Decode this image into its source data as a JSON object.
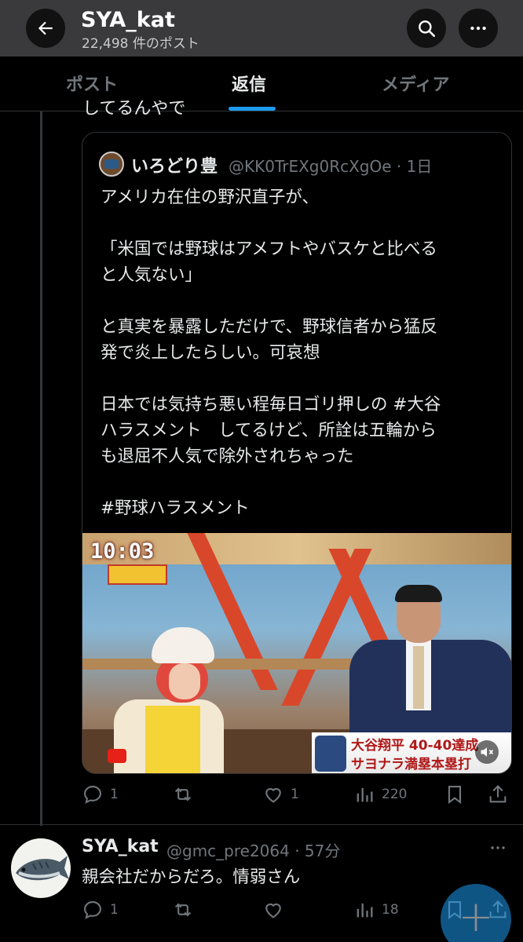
{
  "header": {
    "title": "SYA_kat",
    "post_count": "22,498 件のポスト"
  },
  "tabs": [
    {
      "label": "ポスト",
      "active": false
    },
    {
      "label": "返信",
      "active": true
    },
    {
      "label": "メディア",
      "active": false
    }
  ],
  "cut_text": "してるんやで",
  "quote": {
    "name": "いろどり豊",
    "handle_time": "@KK0TrEXg0RcXgOe · 1日",
    "lines": [
      "アメリカ在住の野沢直子が、",
      "",
      "「米国では野球はアメフトやバスケと比べる",
      "と人気ない」",
      "",
      "と真実を暴露しただけで、野球信者から猛反",
      "発で炎上したらしい。可哀想",
      "",
      "日本では気持ち悪い程毎日ゴリ押しの #大谷",
      "ハラスメント　してるけど、所詮は五輪から",
      "も退屈不人気で除外されちゃった",
      "",
      "#野球ハラスメント"
    ],
    "media": {
      "clock": "10:03",
      "caption_line1": "大谷翔平 40-40達成",
      "caption_line2": "サヨナラ満塁本塁打"
    }
  },
  "post_actions": {
    "reply_count": "1",
    "repost_count": "",
    "like_count": "1",
    "views_count": "220"
  },
  "reply": {
    "name": "SYA_kat",
    "handle_time": "@gmc_pre2064 · 57分",
    "text": "親会社だからだろ。情弱さん",
    "reply_count": "1",
    "repost_count": "",
    "like_count": "",
    "views_count": "18"
  },
  "colors": {
    "accent": "#1d9bf0",
    "muted": "#71767b",
    "text": "#e7e9ea",
    "header_bg": "#3a3a3c"
  }
}
